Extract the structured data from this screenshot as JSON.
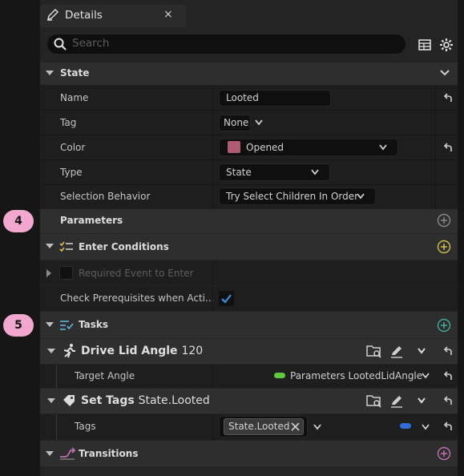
{
  "tab": {
    "title": "Details",
    "close": "×"
  },
  "search": {
    "placeholder": "Search"
  },
  "state": {
    "header": "State",
    "name_label": "Name",
    "name_value": "Looted",
    "tag_label": "Tag",
    "tag_value": "None",
    "color_label": "Color",
    "color_value": "Opened",
    "color_swatch": "#b05a74",
    "type_label": "Type",
    "type_value": "State",
    "selection_label": "Selection Behavior",
    "selection_value": "Try Select Children In Order"
  },
  "parameters": {
    "label": "Parameters"
  },
  "enter_conditions": {
    "header": "Enter Conditions",
    "required_event_label": "Required Event to Enter",
    "check_prereq_label": "Check Prerequisites when Acti..."
  },
  "tasks": {
    "header": "Tasks",
    "drive_lid": {
      "title": "Drive Lid Angle",
      "suffix": "120",
      "target_label": "Target Angle",
      "target_value": "Parameters LootedLidAngle"
    },
    "set_tags": {
      "title": "Set Tags",
      "suffix": "State.Looted",
      "tags_label": "Tags",
      "tag_chip": "State.Looted"
    }
  },
  "transitions": {
    "header": "Transitions"
  },
  "callouts": {
    "four": "4",
    "five": "5"
  },
  "colors": {
    "binding_green": "#5ec93a",
    "binding_blue": "#2e6fd9",
    "checkbox_blue": "#3a8ee6",
    "add_yellow": "#d6c04a",
    "add_teal": "#3fae9b",
    "add_pink": "#c070b4",
    "badge_pink": "#f2a7cf"
  }
}
